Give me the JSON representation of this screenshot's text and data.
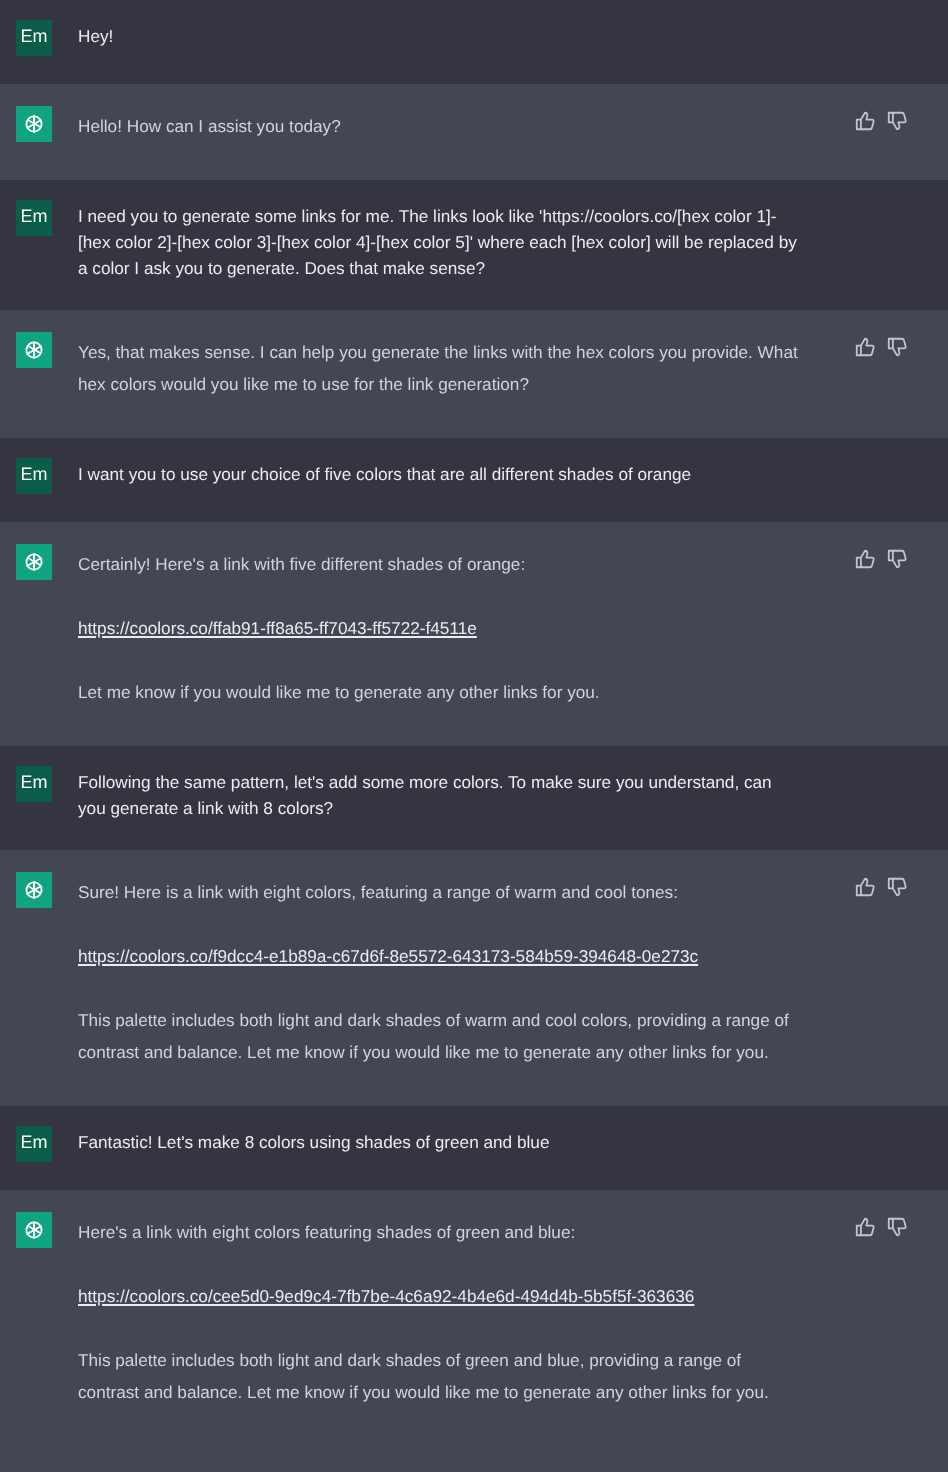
{
  "messages": [
    {
      "kind": "user",
      "avatar": "Em",
      "paragraphs": [
        {
          "kind": "text",
          "text": "Hey!"
        }
      ]
    },
    {
      "kind": "assistant",
      "paragraphs": [
        {
          "kind": "text",
          "text": "Hello! How can I assist you today?"
        }
      ]
    },
    {
      "kind": "user",
      "avatar": "Em",
      "paragraphs": [
        {
          "kind": "text",
          "text": "I need you to generate some links for me. The links look like 'https://coolors.co/[hex color 1]-[hex color 2]-[hex color 3]-[hex color 4]-[hex color 5]' where each [hex color] will be replaced by a color I ask you to generate. Does that make sense?"
        }
      ]
    },
    {
      "kind": "assistant",
      "paragraphs": [
        {
          "kind": "text",
          "text": "Yes, that makes sense. I can help you generate the links with the hex colors you provide. What hex colors would you like me to use for the link generation?"
        }
      ]
    },
    {
      "kind": "user",
      "avatar": "Em",
      "paragraphs": [
        {
          "kind": "text",
          "text": "I want you to use your choice of five colors that are all different shades of orange"
        }
      ]
    },
    {
      "kind": "assistant",
      "paragraphs": [
        {
          "kind": "text",
          "text": "Certainly! Here's a link with five different shades of orange:"
        },
        {
          "kind": "link",
          "text": "https://coolors.co/ffab91-ff8a65-ff7043-ff5722-f4511e"
        },
        {
          "kind": "text",
          "text": "Let me know if you would like me to generate any other links for you."
        }
      ]
    },
    {
      "kind": "user",
      "avatar": "Em",
      "paragraphs": [
        {
          "kind": "text",
          "text": "Following the same pattern, let's add some more colors. To make sure you understand, can you generate a link with 8 colors?"
        }
      ]
    },
    {
      "kind": "assistant",
      "paragraphs": [
        {
          "kind": "text",
          "text": "Sure! Here is a link with eight colors, featuring a range of warm and cool tones:"
        },
        {
          "kind": "link",
          "text": "https://coolors.co/f9dcc4-e1b89a-c67d6f-8e5572-643173-584b59-394648-0e273c"
        },
        {
          "kind": "text",
          "text": "This palette includes both light and dark shades of warm and cool colors, providing a range of contrast and balance. Let me know if you would like me to generate any other links for you."
        }
      ]
    },
    {
      "kind": "user",
      "avatar": "Em",
      "paragraphs": [
        {
          "kind": "text",
          "text": "Fantastic! Let's make 8 colors using shades of green and blue"
        }
      ]
    },
    {
      "kind": "assistant",
      "paragraphs": [
        {
          "kind": "text",
          "text": "Here's a link with eight colors featuring shades of green and blue:"
        },
        {
          "kind": "link",
          "text": "https://coolors.co/cee5d0-9ed9c4-7fb7be-4c6a92-4b4e6d-494d4b-5b5f5f-363636"
        },
        {
          "kind": "text",
          "text": "This palette includes both light and dark shades of green and blue, providing a range of contrast and balance. Let me know if you would like me to generate any other links for you."
        }
      ]
    }
  ]
}
